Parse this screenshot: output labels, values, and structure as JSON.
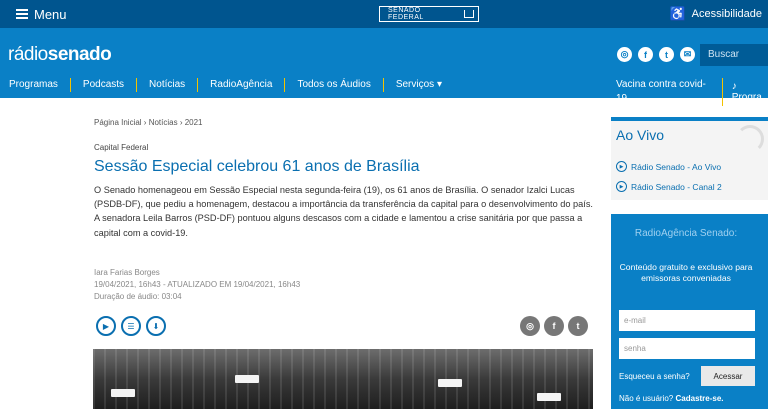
{
  "topbar": {
    "menu_label": "Menu",
    "senado_label": "SENADO FEDERAL",
    "accessibility_label": "Acessibilidade"
  },
  "brand": {
    "logo_part1": "rádio",
    "logo_part2": "senado",
    "search_placeholder": "Buscar",
    "socials": [
      {
        "icon": "whatsapp-icon",
        "glyph": "◎"
      },
      {
        "icon": "facebook-icon",
        "glyph": "f"
      },
      {
        "icon": "twitter-icon",
        "glyph": "t"
      },
      {
        "icon": "email-icon",
        "glyph": "✉"
      }
    ]
  },
  "nav": {
    "items": [
      "Programas",
      "Podcasts",
      "Notícias",
      "RadioAgência",
      "Todos os Áudios",
      "Serviços ▾"
    ],
    "right_item_1": "Vacina contra covid-19",
    "right_item_2": "♪ Progra"
  },
  "article": {
    "breadcrumb": "Página Inicial ›  Notícias ›  2021",
    "section": "Capital Federal",
    "title": "Sessão Especial celebrou 61 anos de Brasília",
    "lead": "O Senado homenageou em Sessão Especial nesta segunda-feira (19), os 61 anos de Brasília. O senador Izalci Lucas (PSDB-DF), que pediu a homenagem, destacou a importância da transferência da capital para o desenvolvimento do país. A senadora Leila Barros (PSD-DF) pontuou alguns descasos com a cidade e lamentou a crise sanitária por que passa a capital com a covid-19.",
    "author": "Iara Farias Borges",
    "dates": "19/04/2021, 16h43 - ATUALIZADO EM 19/04/2021, 16h43",
    "duration": "Duração de áudio: 03:04"
  },
  "sidebar": {
    "aovivo_title": "Ao Vivo",
    "live_1": "Rádio Senado - Ao Vivo",
    "live_2": "Rádio Senado - Canal 2",
    "agencia_title": "RadioAgência Senado:",
    "agencia_desc": "Conteúdo gratuito e exclusivo para emissoras conveniadas",
    "email_placeholder": "e-mail",
    "password_placeholder": "senha",
    "forgot_label": "Esqueceu a senha?",
    "access_button": "Acessar",
    "signup_prefix": "Não é usuário?",
    "signup_link": "Cadastre-se."
  },
  "colors": {
    "topbar": "#00558f",
    "brandbar": "#0a80c6",
    "accent_yellow": "#f2c200",
    "title_blue": "#0a6fb0"
  }
}
